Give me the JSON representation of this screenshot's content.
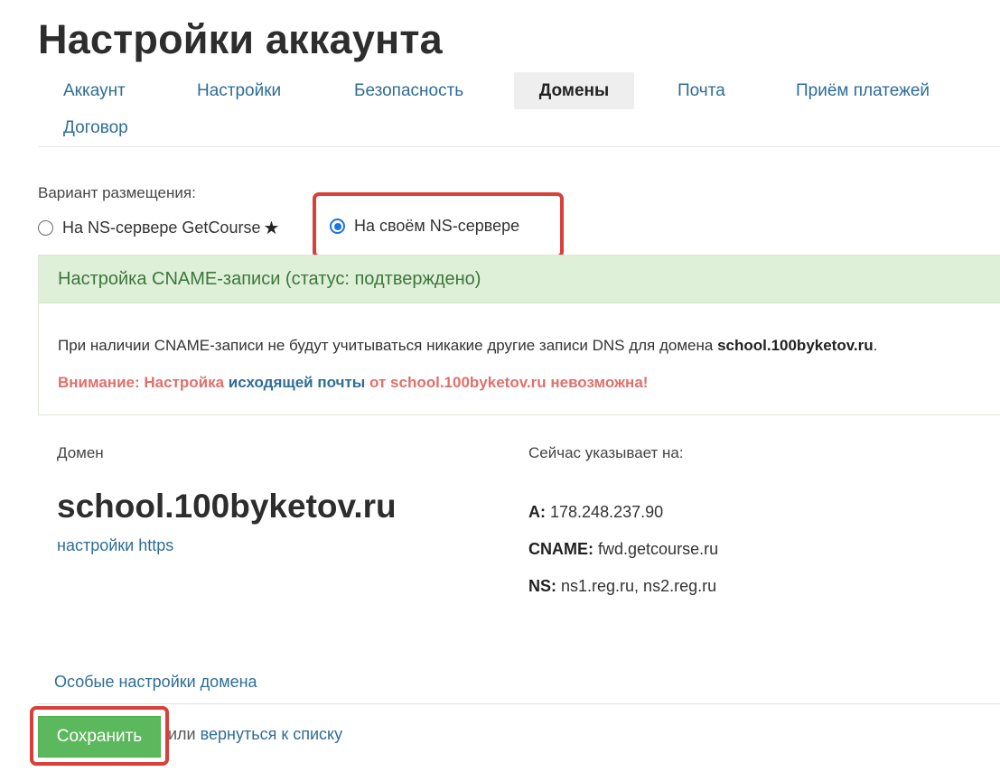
{
  "page": {
    "title": "Настройки аккаунта"
  },
  "tabs": [
    {
      "label": "Аккаунт",
      "active": false
    },
    {
      "label": "Настройки",
      "active": false
    },
    {
      "label": "Безопасность",
      "active": false
    },
    {
      "label": "Домены",
      "active": true
    },
    {
      "label": "Почта",
      "active": false
    },
    {
      "label": "Приём платежей",
      "active": false
    },
    {
      "label": "Договор",
      "active": false
    }
  ],
  "placement": {
    "label": "Вариант размещения:",
    "options": [
      {
        "label": "На NS-сервере GetCourse",
        "checked": false,
        "icon": "star-icon",
        "star": "★"
      },
      {
        "label": "На своём NS-сервере",
        "checked": true
      }
    ]
  },
  "cname": {
    "header": "Настройка CNAME-записи (статус: подтверждено)",
    "info_prefix": "При наличии CNAME-записи не будут учитываться никакие другие записи DNS для домена",
    "info_domain": "school.100byketov.ru",
    "info_suffix": ".",
    "warning_prefix": "Внимание: Настройка",
    "warning_link": "исходящей почты",
    "warning_suffix": "от school.100byketov.ru невозможна!"
  },
  "domain": {
    "label": "Домен",
    "name": "school.100byketov.ru",
    "https_link": "настройки https"
  },
  "points_to": {
    "label": "Сейчас указывает на:",
    "records": [
      {
        "type": "A:",
        "value": "178.248.237.90"
      },
      {
        "type": "CNAME:",
        "value": "fwd.getcourse.ru"
      },
      {
        "type": "NS:",
        "value": "ns1.reg.ru, ns2.reg.ru"
      }
    ]
  },
  "footer": {
    "special_settings": "Особые настройки домена",
    "save_label": "Сохранить",
    "or_text": "или",
    "back_link": "вернуться к списку"
  },
  "colors": {
    "accent_link": "#2e6d95",
    "success_bg": "#dff0d8",
    "success_text": "#3c763d",
    "warning_text": "#e0706b",
    "save_button": "#5cb85c",
    "highlight_border": "#d9403a",
    "radio_checked": "#1a73e8"
  }
}
